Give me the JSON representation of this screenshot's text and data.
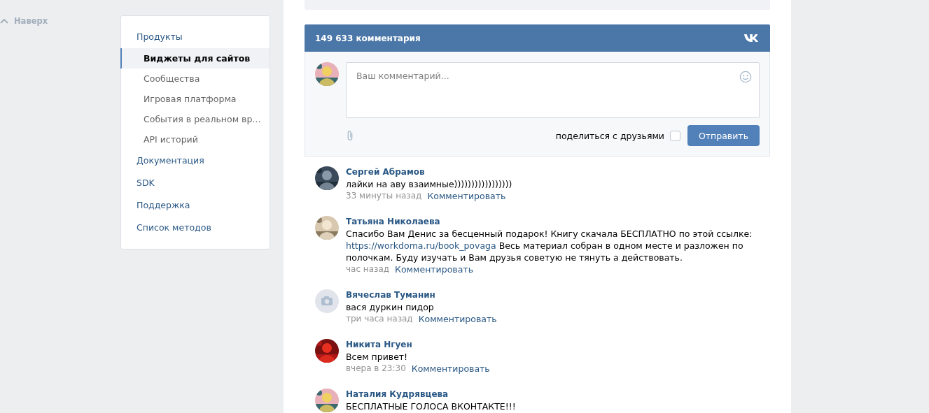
{
  "back_link": {
    "label": "Наверх"
  },
  "menu": {
    "items": [
      {
        "label": "Продукты",
        "selected": false,
        "children": [
          {
            "label": "Виджеты для сайтов",
            "selected": true
          },
          {
            "label": "Сообщества",
            "selected": false
          },
          {
            "label": "Игровая платформа",
            "selected": false
          },
          {
            "label": "События в реальном вр…",
            "selected": false
          },
          {
            "label": "API историй",
            "selected": false
          }
        ]
      },
      {
        "label": "Документация",
        "selected": false
      },
      {
        "label": "SDK",
        "selected": false
      },
      {
        "label": "Поддержка",
        "selected": false
      },
      {
        "label": "Список методов",
        "selected": false
      }
    ]
  },
  "widget": {
    "title": "149 633 комментария",
    "form": {
      "placeholder": "Ваш комментарий...",
      "share_label": "поделиться с друзьями",
      "share_checked": false,
      "submit": "Отправить"
    },
    "comments": [
      {
        "author": "Сергей Абрамов",
        "parts": [
          {
            "kind": "text",
            "text": "лайки на аву взаимные)))))))))))))))))"
          }
        ],
        "time": "33 минуты назад",
        "action": "Комментировать"
      },
      {
        "author": "Татьяна Николаева",
        "parts": [
          {
            "kind": "text",
            "text": "Спасибо Вам Денис за бесценный подарок! Книгу скачала БЕСПЛАТНО по этой ссылке: "
          },
          {
            "kind": "link",
            "text": "https://workdoma.ru/book_povaga"
          },
          {
            "kind": "text",
            "text": " Весь материал собран в одном месте и разложен по полочкам. Буду изучать и Вам друзья советую не тянуть а действовать."
          }
        ],
        "time": "час назад",
        "action": "Комментировать"
      },
      {
        "avatar": {
          "kind": "placeholder"
        },
        "author": "Вячеслав Туманин",
        "parts": [
          {
            "kind": "text",
            "text": "вася дуркин пидор"
          }
        ],
        "time": "три часа назад",
        "action": "Комментировать"
      },
      {
        "author": "Никита Нгуен",
        "parts": [
          {
            "kind": "text",
            "text": "Всем привет!"
          }
        ],
        "time": "вчера в 23:30",
        "action": "Комментировать"
      },
      {
        "author": "Наталия Кудрявцева",
        "parts": [
          {
            "kind": "text",
            "text": "БЕСПЛАТНЫЕ ГОЛОСА ВКОНТАКТЕ!!!"
          }
        ]
      }
    ]
  }
}
